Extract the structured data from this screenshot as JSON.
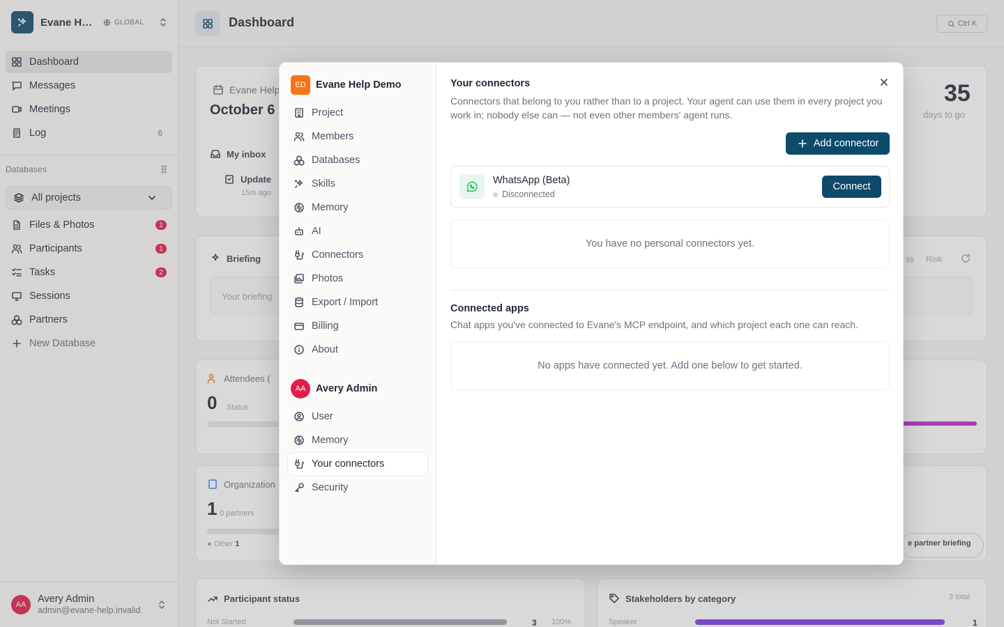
{
  "workspace": {
    "name": "Evane Help Demo",
    "scope": "GLOBAL"
  },
  "nav": [
    {
      "label": "Dashboard",
      "icon": "dashboard-icon"
    },
    {
      "label": "Messages",
      "icon": "message-icon"
    },
    {
      "label": "Meetings",
      "icon": "video-icon"
    },
    {
      "label": "Log",
      "icon": "log-icon",
      "count": "6"
    }
  ],
  "databases": {
    "label": "Databases",
    "selector": "All projects",
    "items": [
      {
        "label": "Files & Photos",
        "badge": "1"
      },
      {
        "label": "Participants",
        "badge": "1"
      },
      {
        "label": "Tasks",
        "badge": "2"
      },
      {
        "label": "Sessions"
      },
      {
        "label": "Partners"
      }
    ],
    "new_label": "New Database"
  },
  "user": {
    "initials": "AA",
    "name": "Avery Admin",
    "email": "admin@evane-help.invalid"
  },
  "main": {
    "title": "Dashboard",
    "shortcut": "Ctrl K",
    "event_name": "Evane Help",
    "event_date": "October 6",
    "countdown": "35",
    "countdown_label": "days to go",
    "inbox": "My inbox",
    "inbox_item": "Update",
    "inbox_time": "15m ago",
    "briefing": "Briefing",
    "briefing_text": "Your briefing",
    "briefing_tabs": [
      "ss",
      "Risk"
    ],
    "attendees": "Attendees (",
    "attendees_value": "0",
    "attendees_sub": "Status",
    "org": "Organization",
    "org_value": "1",
    "org_sub": "0 partners",
    "org_other": "Other",
    "org_other_value": "1",
    "partner_brief": "e partner briefing",
    "participant_status": "Participant status",
    "not_started": "Not Started",
    "ns_count": "3",
    "ns_pct": "100%",
    "stakeholders": "Stakeholders by category",
    "stake_total": "3 total",
    "speaker": "Speaker",
    "speaker_count": "1"
  },
  "modal": {
    "org": {
      "initials": "ED",
      "name": "Evane Help Demo"
    },
    "org_items": [
      {
        "label": "Project",
        "icon": "building-icon"
      },
      {
        "label": "Members",
        "icon": "users-icon"
      },
      {
        "label": "Databases",
        "icon": "blocks-icon"
      },
      {
        "label": "Skills",
        "icon": "sparkles-icon"
      },
      {
        "label": "Memory",
        "icon": "brain-icon"
      },
      {
        "label": "AI",
        "icon": "bot-icon"
      },
      {
        "label": "Connectors",
        "icon": "plug-icon"
      },
      {
        "label": "Photos",
        "icon": "images-icon"
      },
      {
        "label": "Export / Import",
        "icon": "database-icon"
      },
      {
        "label": "Billing",
        "icon": "credit-card-icon"
      },
      {
        "label": "About",
        "icon": "info-icon"
      }
    ],
    "user": {
      "initials": "AA",
      "name": "Avery Admin"
    },
    "user_items": [
      {
        "label": "User",
        "icon": "user-circle-icon"
      },
      {
        "label": "Memory",
        "icon": "brain-icon"
      },
      {
        "label": "Your connectors",
        "icon": "plug-icon",
        "active": true
      },
      {
        "label": "Security",
        "icon": "key-icon"
      }
    ],
    "title": "Your connectors",
    "description": "Connectors that belong to you rather than to a project. Your agent can use them in every project you work in; nobody else can — not even other members' agent runs.",
    "add_label": "Add connector",
    "connector": {
      "name": "WhatsApp (Beta)",
      "status": "Disconnected",
      "action": "Connect"
    },
    "empty_personal": "You have no personal connectors yet.",
    "apps_title": "Connected apps",
    "apps_description": "Chat apps you've connected to Evane's MCP endpoint, and which project each one can reach.",
    "empty_apps": "No apps have connected yet. Add one below to get started."
  },
  "colors": {
    "brand": "#0e4a6b",
    "badge": "#e11d48",
    "org_avatar": "#f97316",
    "whatsapp": "#22c55e"
  }
}
